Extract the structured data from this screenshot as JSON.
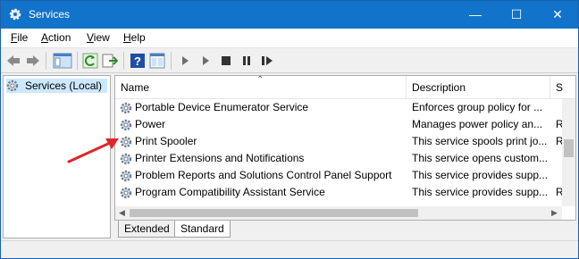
{
  "window": {
    "title": "Services",
    "minimize_glyph": "—",
    "maximize_glyph": "☐",
    "close_glyph": "✕"
  },
  "menu": {
    "items": [
      {
        "accel": "F",
        "rest": "ile"
      },
      {
        "accel": "A",
        "rest": "ction"
      },
      {
        "accel": "V",
        "rest": "iew"
      },
      {
        "accel": "H",
        "rest": "elp"
      }
    ]
  },
  "toolbar": {
    "icons": [
      "back-icon",
      "forward-icon",
      "show-hide-console-tree-icon",
      "refresh-icon",
      "export-list-icon",
      "help-icon",
      "properties-icon",
      "start-service-icon",
      "stop-service-icon",
      "pause-service-icon",
      "restart-service-icon"
    ]
  },
  "tree": {
    "selected_label": "Services (Local)"
  },
  "list": {
    "columns": {
      "name": "Name",
      "description": "Description",
      "status": "S"
    },
    "rows": [
      {
        "name": "Portable Device Enumerator Service",
        "description": "Enforces group policy for ...",
        "status": ""
      },
      {
        "name": "Power",
        "description": "Manages power policy an...",
        "status": "R"
      },
      {
        "name": "Print Spooler",
        "description": "This service spools print jo...",
        "status": "R"
      },
      {
        "name": "Printer Extensions and Notifications",
        "description": "This service opens custom...",
        "status": ""
      },
      {
        "name": "Problem Reports and Solutions Control Panel Support",
        "description": "This service provides supp...",
        "status": ""
      },
      {
        "name": "Program Compatibility Assistant Service",
        "description": "This service provides supp...",
        "status": "R"
      }
    ]
  },
  "tabs": {
    "extended": "Extended",
    "standard": "Standard"
  },
  "colors": {
    "titlebar": "#1173c9",
    "selection": "#cce8ff",
    "annotation_arrow": "#e0262a"
  }
}
